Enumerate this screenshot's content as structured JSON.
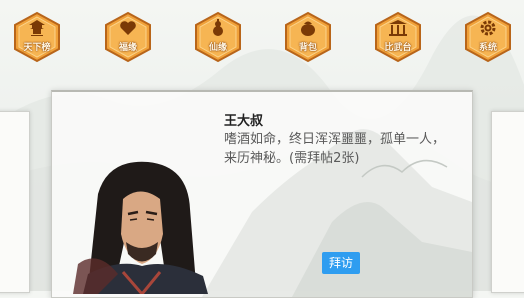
{
  "menu": {
    "items": [
      {
        "label": "天下榜",
        "icon": "pagoda-icon"
      },
      {
        "label": "福缘",
        "icon": "hearts-icon"
      },
      {
        "label": "仙缘",
        "icon": "gourd-icon"
      },
      {
        "label": "背包",
        "icon": "bag-icon"
      },
      {
        "label": "比武台",
        "icon": "arena-icon"
      },
      {
        "label": "系统",
        "icon": "gear-icon"
      }
    ]
  },
  "npc": {
    "name": "王大叔",
    "desc_line1": "嗜酒如命，终日浑浑噩噩，孤单一人，",
    "desc_line2": "来历神秘。(需拜帖2张)",
    "visit_label": "拜访"
  },
  "colors": {
    "hex_fill": "#f0a13a",
    "hex_border": "#b8651a",
    "button": "#2f9df0"
  }
}
